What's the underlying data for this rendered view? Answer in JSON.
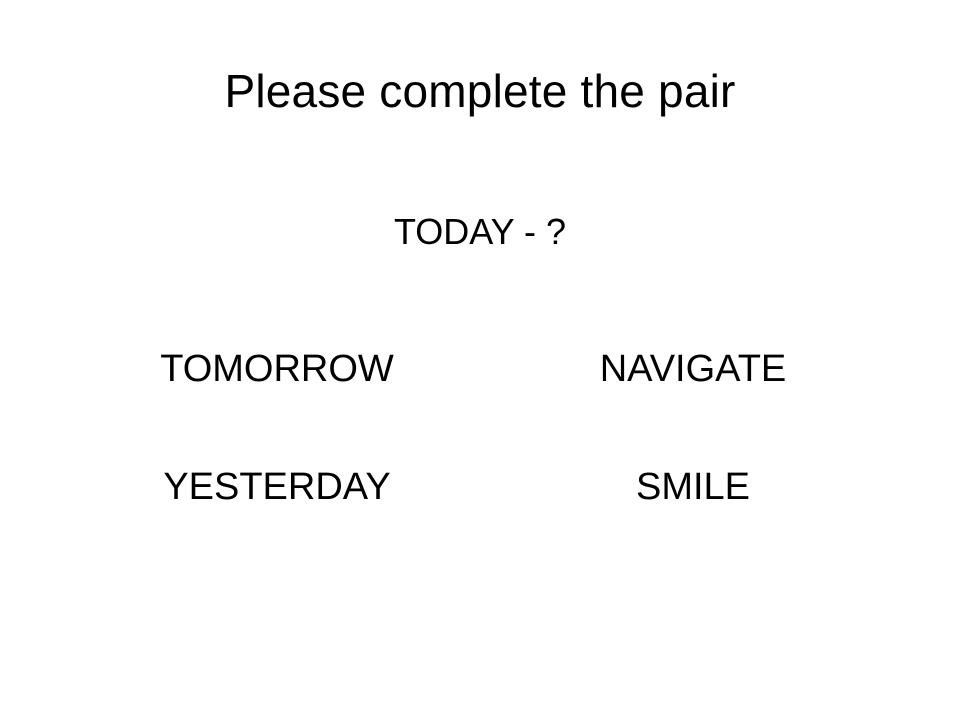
{
  "slide": {
    "title": "Please complete the pair",
    "prompt": "TODAY - ?",
    "options": [
      "TOMORROW",
      "NAVIGATE",
      "YESTERDAY",
      "SMILE"
    ]
  }
}
